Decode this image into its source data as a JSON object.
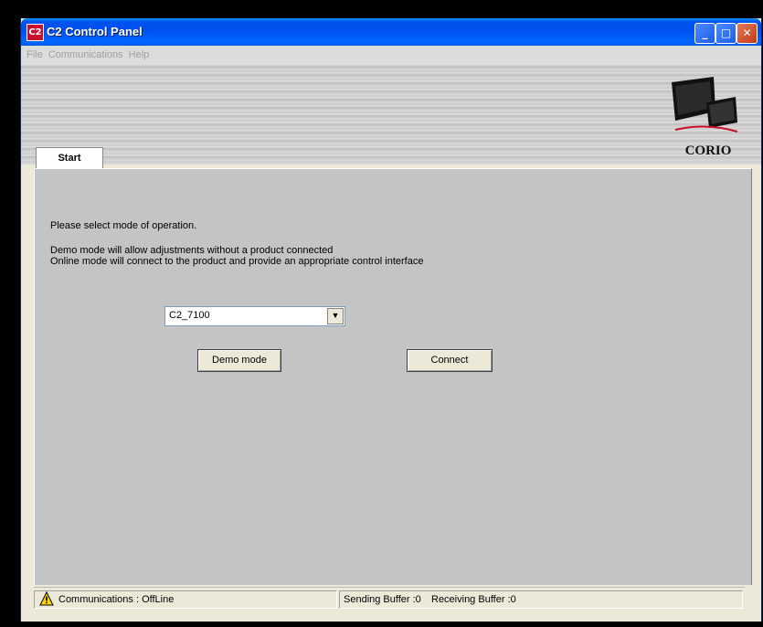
{
  "window": {
    "title": "C2 Control Panel",
    "app_icon_text": "C2",
    "minimize_label": "_",
    "maximize_label": "□",
    "close_label": "✕"
  },
  "menubar": {
    "items": [
      "File",
      "Communications",
      "Help"
    ]
  },
  "banner": {
    "logo_text": "CORIO"
  },
  "tabs": [
    {
      "label": "Start",
      "active": true
    }
  ],
  "start_panel": {
    "prompt": "Please select mode of operation.",
    "demo_description": "Demo mode will allow adjustments without a product connected",
    "online_description": "Online mode will connect to the product and provide an appropriate control interface",
    "model_select": {
      "value": "C2_7100",
      "arrow": "▼"
    },
    "demo_button": "Demo mode",
    "connect_button": "Connect"
  },
  "statusbar": {
    "communications": "Communications : OffLine",
    "sending_buffer": "Sending Buffer :0",
    "receiving_buffer": "Receiving Buffer :0"
  },
  "colors": {
    "titlebar": "#0054e3",
    "panel": "#c4c4c4",
    "button_face": "#ece9d8",
    "warning": "#ffd200"
  },
  "icons": [
    "c2-app-icon",
    "minimize-icon",
    "maximize-icon",
    "close-icon",
    "corio-monitor-icon",
    "chevron-down-icon",
    "warning-icon"
  ]
}
